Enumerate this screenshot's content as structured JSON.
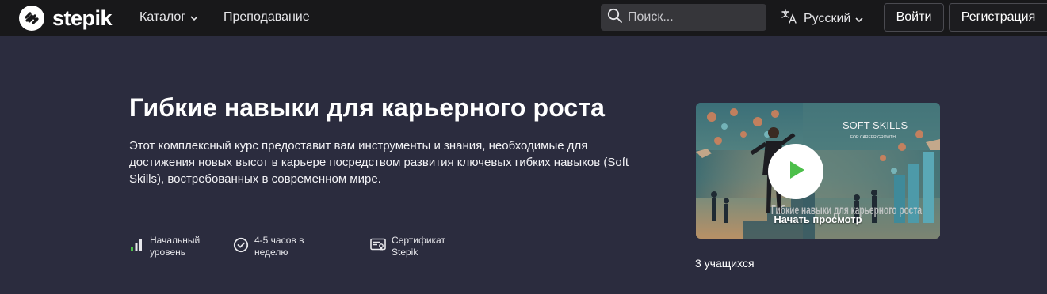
{
  "header": {
    "brand": "stepik",
    "nav": {
      "catalog": "Каталог",
      "teaching": "Преподавание"
    },
    "search": {
      "placeholder": "Поиск..."
    },
    "language": "Русский",
    "login": "Войти",
    "register": "Регистрация"
  },
  "course": {
    "title": "Гибкие навыки для карьерного роста",
    "description": "Этот комплексный курс предоставит вам инструменты и знания, необходимые для достижения новых высот в карьере посредством развития ключевых гибких навыков (Soft Skills), востребованных в современном мире.",
    "features": {
      "level": "Начальный уровень",
      "time": "4-5 часов в неделю",
      "certificate": "Сертификат Stepik"
    },
    "preview": {
      "label": "Начать просмотр",
      "image_text_top": "SOFT SKILLS",
      "image_text_sub": "FOR CAREER GROWTH",
      "image_text_bottom": "Гибкие навыки для карьерного роста"
    },
    "learners": "3 учащихся"
  },
  "colors": {
    "page_bg": "#2b2c3e",
    "navbar_bg": "#18181a",
    "play_green": "#4cbf4a",
    "level_green": "#4cbf4a"
  },
  "icons": {
    "logo": "stepik-logo-icon",
    "catalog_chevron": "chevron-down-icon",
    "search": "search-icon",
    "language": "translate-icon",
    "level": "level-bars-icon",
    "time": "clock-icon",
    "certificate": "certificate-icon",
    "play": "play-icon"
  }
}
